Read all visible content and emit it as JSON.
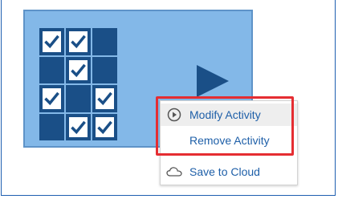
{
  "menu": {
    "items": [
      {
        "label": "Modify Activity",
        "icon": "play-circle-icon"
      },
      {
        "label": "Remove Activity",
        "icon": ""
      },
      {
        "label": "Save to Cloud",
        "icon": "cloud-icon"
      }
    ]
  },
  "tile": {
    "grid": [
      [
        "checked",
        "checked",
        "dark",
        "empty"
      ],
      [
        "dark",
        "checked",
        "dark",
        "empty"
      ],
      [
        "checked",
        "dark",
        "checked",
        "empty"
      ],
      [
        "dark",
        "checked",
        "checked",
        "empty"
      ]
    ]
  },
  "colors": {
    "tile_bg": "#83b8e8",
    "dark_cell": "#1a4f87",
    "link_text": "#1e5fa8",
    "highlight": "#e52d32"
  }
}
